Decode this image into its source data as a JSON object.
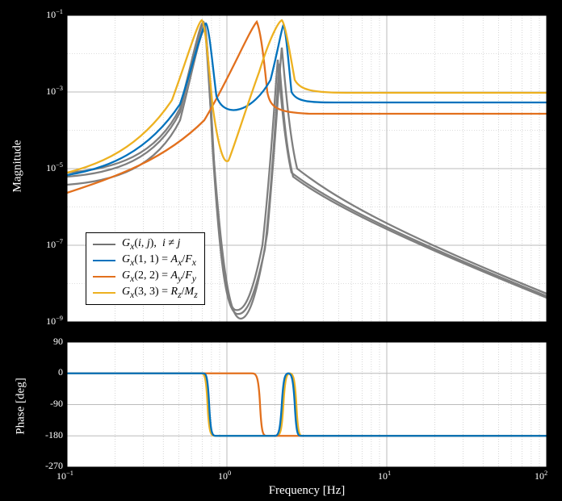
{
  "chart_data": [
    {
      "type": "line",
      "title": "",
      "xlabel": "Frequency [Hz]",
      "ylabel": "Magnitude",
      "xscale": "log",
      "yscale": "log",
      "xlim": [
        0.1,
        100
      ],
      "ylim": [
        1e-09,
        0.1
      ],
      "xticks": [
        0.1,
        1,
        10,
        100
      ],
      "yticks": [
        1e-09,
        1e-07,
        1e-05,
        0.001,
        0.1
      ],
      "legend": {
        "position": "lower-left",
        "entries": [
          {
            "label": "G_x(i,j),  i ≠ j",
            "color": "#727272"
          },
          {
            "label": "G_x(1,1) = A_x/F_x",
            "color": "#0072bd"
          },
          {
            "label": "G_x(2,2) = A_y/F_y",
            "color": "#e2701d"
          },
          {
            "label": "G_x(3,3) = R_z/M_z",
            "color": "#edb120"
          }
        ]
      },
      "series": [
        {
          "name": "G_x(i,j) off-diag",
          "color": "#727272",
          "description": "multiple gray off-diagonal transfer functions, generally lower magnitude, rolling off at high freq"
        },
        {
          "name": "G_x(1,1)",
          "color": "#0072bd",
          "resonance_hz": 1.8,
          "antiresonance_hz": 2.7,
          "flat_above_hz_mag": 0.0002
        },
        {
          "name": "G_x(2,2)",
          "color": "#e2701d",
          "resonance_hz": 1.6,
          "flat_above_hz_mag": 0.0001
        },
        {
          "name": "G_x(3,3)",
          "color": "#edb120",
          "resonances_hz": [
            0.8,
            2.0
          ],
          "antiresonance_hz": 1.2,
          "flat_above_hz_mag": 0.0003
        }
      ]
    },
    {
      "type": "line",
      "title": "",
      "xlabel": "Frequency [Hz]",
      "ylabel": "Phase [deg]",
      "xscale": "log",
      "xlim": [
        0.1,
        100
      ],
      "ylim": [
        -270,
        90
      ],
      "yticks": [
        -270,
        -180,
        -90,
        0,
        90
      ],
      "series": [
        {
          "name": "G_x(1,1)",
          "color": "#0072bd",
          "phase_low": 0,
          "phase_high": -180,
          "transition_hz": 1.8
        },
        {
          "name": "G_x(2,2)",
          "color": "#e2701d",
          "phase_low": 0,
          "phase_high": -180,
          "transition_hz": 1.5
        },
        {
          "name": "G_x(3,3)",
          "color": "#edb120",
          "phase_low": 0,
          "phase_high": -180,
          "transition_hz": 0.85
        }
      ]
    }
  ],
  "axes": {
    "mag": {
      "ylabel": "Magnitude",
      "yticks": [
        "10⁻⁹",
        "10⁻⁷",
        "10⁻⁵",
        "10⁻³",
        "10⁻¹"
      ],
      "ytick_exp": [
        -9,
        -7,
        -5,
        -3,
        -1
      ]
    },
    "phase": {
      "ylabel": "Phase [deg]",
      "xlabel": "Frequency [Hz]",
      "yticks": [
        "-270",
        "-180",
        "-90",
        "0",
        "90"
      ],
      "xticks": [
        "10⁻¹",
        "10⁰",
        "10¹",
        "10²"
      ],
      "xtick_exp": [
        -1,
        0,
        1,
        2
      ]
    }
  },
  "legend": {
    "items": [
      {
        "color": "#727272",
        "label_html": "G<sub>x</sub>(i, j),  i ≠ j"
      },
      {
        "color": "#0072bd",
        "label_html": "G<sub>x</sub>(1, 1) = A<sub>x</sub>/F<sub>x</sub>"
      },
      {
        "color": "#e2701d",
        "label_html": "G<sub>x</sub>(2, 2) = A<sub>y</sub>/F<sub>y</sub>"
      },
      {
        "color": "#edb120",
        "label_html": "G<sub>x</sub>(3, 3) = R<sub>z</sub>/M<sub>z</sub>"
      }
    ]
  }
}
